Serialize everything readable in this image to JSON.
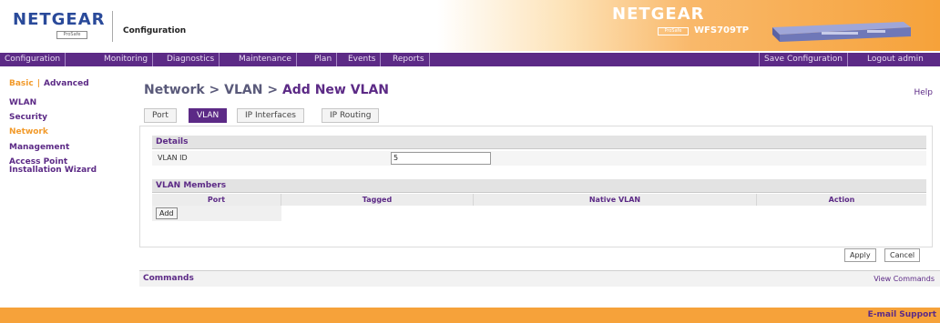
{
  "header": {
    "logo_text": "NETGEAR",
    "logo_sub": "ProSafe",
    "title": "Configuration",
    "brand_text": "NETGEAR",
    "brand_sub": "ProSafe",
    "model": "WFS709TP"
  },
  "nav": {
    "left": [
      "Configuration",
      "Monitoring",
      "Diagnostics",
      "Maintenance",
      "Plan",
      "Events",
      "Reports"
    ],
    "save": "Save Configuration",
    "logout": "Logout admin"
  },
  "sidebar": {
    "basic": "Basic",
    "separator": "|",
    "advanced": "Advanced",
    "links": [
      "WLAN",
      "Security",
      "Network",
      "Management",
      "Access Point",
      "Installation Wizard"
    ]
  },
  "page": {
    "crumb": "Network > VLAN > ",
    "current": "Add New VLAN",
    "help": "Help"
  },
  "tabs": [
    "Port",
    "VLAN",
    "IP Interfaces",
    "IP Routing"
  ],
  "details": {
    "heading": "Details",
    "vlan_id_label": "VLAN ID",
    "vlan_id_value": "5"
  },
  "members": {
    "heading": "VLAN Members",
    "columns": [
      "Port",
      "Tagged",
      "Native VLAN",
      "Action"
    ],
    "add_label": "Add"
  },
  "actions": {
    "apply": "Apply",
    "cancel": "Cancel"
  },
  "commands": {
    "title": "Commands",
    "view": "View Commands"
  },
  "footer": {
    "email_support": "E-mail Support"
  },
  "colors": {
    "purple": "#5c2a86",
    "orange": "#f6a23a",
    "accent_orange_text": "#f29a2a"
  }
}
